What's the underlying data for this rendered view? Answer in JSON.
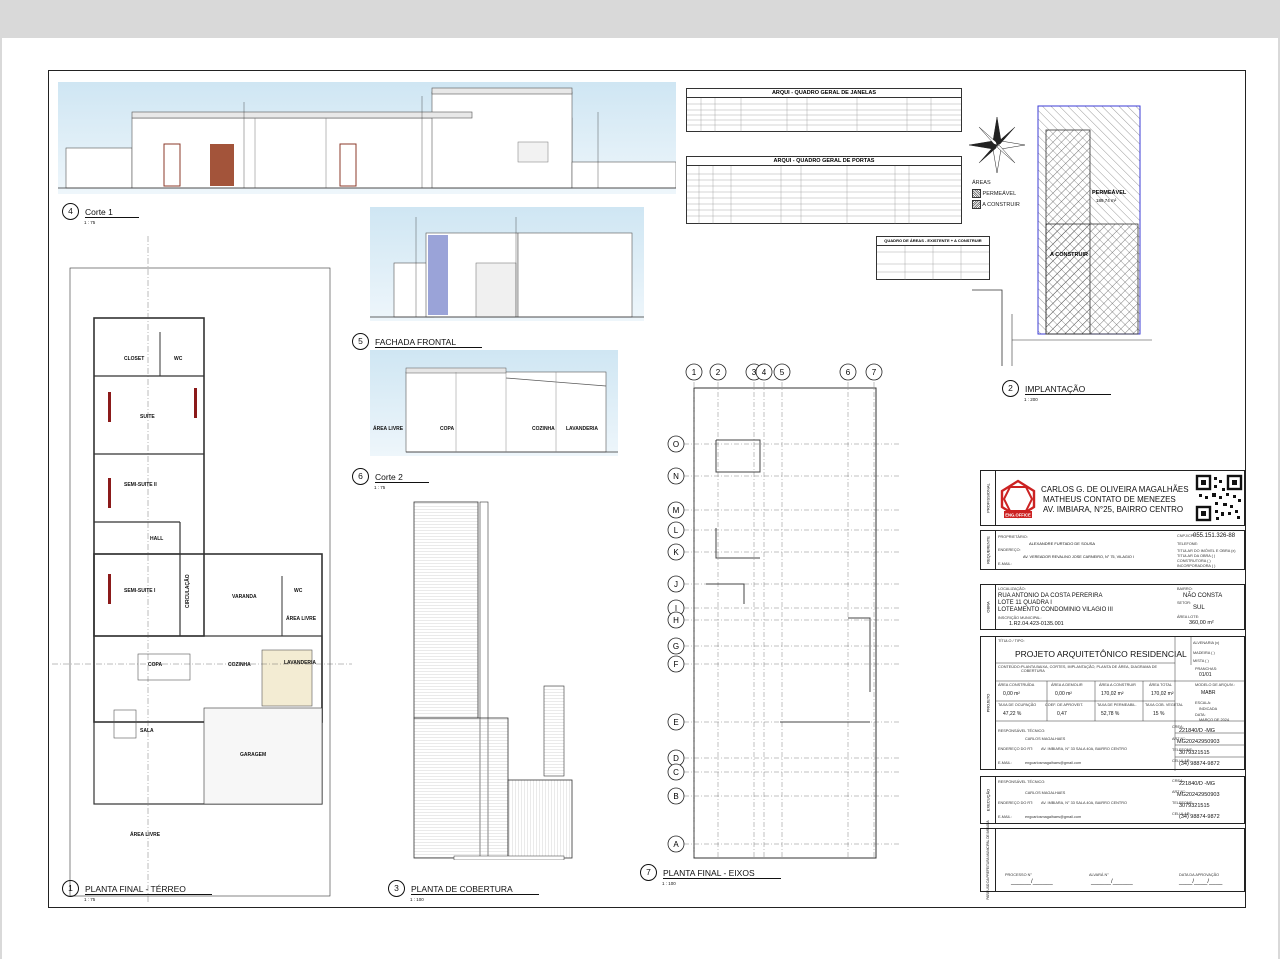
{
  "views": {
    "v1": {
      "num": "1",
      "name": "PLANTA FINAL - TÉRREO",
      "scale": "1 : 75"
    },
    "v2": {
      "num": "2",
      "name": "IMPLANTAÇÃO",
      "scale": "1 : 200"
    },
    "v3": {
      "num": "3",
      "name": "PLANTA DE COBERTURA",
      "scale": "1 : 100"
    },
    "v4": {
      "num": "4",
      "name": "Corte 1",
      "scale": "1 : 75"
    },
    "v5": {
      "num": "5",
      "name": "FACHADA FRONTAL",
      "scale": "1 : 75"
    },
    "v6": {
      "num": "6",
      "name": "Corte 2",
      "scale": "1 : 75"
    },
    "v7": {
      "num": "7",
      "name": "PLANTA FINAL - EIXOS",
      "scale": "1 : 100"
    }
  },
  "rooms": {
    "closet": "CLOSET",
    "wc": "WC",
    "suite": "SUITE",
    "semisuite2": "SEMI-SUITE II",
    "hall": "HALL",
    "semisuite1": "SEMI-SUITE I",
    "circulacao": "CIRCULAÇÃO",
    "varanda": "VARANDA",
    "wc2": "WC",
    "arealivre": "ÁREA LIVRE",
    "copa": "COPA",
    "cozinha": "COZINHA",
    "lavanderia": "LAVANDERIA",
    "sala": "SALA",
    "garagem": "GARAGEM",
    "arealivre2": "ÁREA LIVRE"
  },
  "corte2": {
    "arealivre": "ÁREA LIVRE",
    "copa": "COPA",
    "cozinha": "COZINHA",
    "lavanderia": "LAVANDERIA"
  },
  "implantacao": {
    "permeavel": "PERMEÁVEL",
    "permeavel_area": "189,74 m²",
    "aconstruir": "A CONSTRUIR"
  },
  "legend": {
    "title": "ÁREAS",
    "permeavel": "PERMEÁVEL",
    "aconstruir": "A CONSTRUIR"
  },
  "tables": {
    "janelas": "ARQUI - QUADRO GERAL DE JANELAS",
    "portas": "ARQUI - QUADRO GERAL DE PORTAS",
    "areas": "QUADRO DE ÁREAS - EXISTENTE + A CONSTRUIR"
  },
  "axes": {
    "cols": [
      "1",
      "2",
      "3",
      "4",
      "5",
      "6",
      "7"
    ],
    "rows": [
      "O",
      "N",
      "M",
      "L",
      "K",
      "J",
      "I",
      "H",
      "G",
      "F",
      "E",
      "D",
      "C",
      "B",
      "A"
    ]
  },
  "titleblock": {
    "company_line1": "CARLOS G. DE OLIVEIRA MAGALHÃES",
    "company_line2": "MATHEUS CONTATO DE MENEZES",
    "company_line3": "AV. IMBIARA, N°25, BAIRRO CENTRO",
    "logo_text": "ENG.OFFICE",
    "side_profissional": "PROFISSIONAL",
    "side_requerente": "REQUERENTE",
    "side_obra": "OBRA",
    "side_projeto": "PROJETO",
    "side_execucao": "EXECUÇÃO",
    "side_prefeitura": "PARA USO DA PREFEITURA MUNICIPAL DE IMBIARA",
    "proprietario_lbl": "PROPRIETÁRIO:",
    "proprietario": "ALEXANDRE FURTADO DE SOUSA",
    "endereco_lbl": "ENDEREÇO:",
    "endereco": "AV. VEREADOR REVALINO JOSE CARNEIRO, N° 75, VILAGIO I",
    "email_lbl": "E-MAIL:",
    "cpf_lbl": "CNPJ/CPF:",
    "cpf": "055.151.326-88",
    "telefone_lbl": "TELEFONE:",
    "tit1": "TITULAR DO IMÓVEL E OBRA (x)",
    "tit2": "TITULAR DA OBRA ( )",
    "tit3": "CONSTRUTORA ( )",
    "tit4": "INCORPORADORA ( )",
    "localizacao_lbl": "LOCALIZAÇÃO:",
    "loc1": "RUA ANTONIO DA COSTA PERERIRA",
    "loc2": "LOTE 11 QUADRA I",
    "loc3": "LOTEAMENTO CONDOMINIO VILAGIO III",
    "inscricao_lbl": "INSCRIÇÃO MUNICIPAL:",
    "inscricao": "1.R2.04.423-0135.001",
    "bairro_lbl": "BAIRRO:",
    "bairro": "NÃO CONSTA",
    "setor_lbl": "SETOR:",
    "setor": "SUL",
    "area_lote_lbl": "ÁREA LOTE:",
    "area_lote": "360,00 m²",
    "titulo_lbl": "TÍTULO / TIPO:",
    "titulo": "PROJETO ARQUITETÔNICO RESIDENCIAL",
    "conteudo_lbl": "CONTEÚDO:",
    "conteudo": "PLANTA BAIXA, CORTES, IMPLANTAÇÃO, PLANTA DE ÁREA, DIAGRAMA DE COBERTURA",
    "alvenaria": "ALVENARIA (x)",
    "madeira": "MADEIRA ( )",
    "mista": "MISTA ( )",
    "pranchas_lbl": "PRANCHAS:",
    "pranchas": "01/01",
    "modelo_lbl": "MODELO DE ARQUIV.:",
    "modelo": "MABR",
    "escala_lbl": "ESCALA:",
    "escala": "INDICADA",
    "data_lbl": "DATA:",
    "data": "MARÇO DE 2024",
    "area_constr_lbl": "ÁREA CONSTRUÍDA",
    "area_constr": "0,00 m²",
    "area_demolir_lbl": "ÁREA A DEMOLIR",
    "area_demolir": "0,00 m²",
    "area_aconstr_lbl": "ÁREA A CONSTRUIR",
    "area_aconstr": "170,02 m²",
    "area_total_lbl": "ÁREA TOTAL",
    "area_total": "170,02 m²",
    "taxa_ocup_lbl": "TAXA DE OCUPAÇÃO",
    "taxa_ocup": "47,22 %",
    "coef_lbl": "COEF. DE APROVEIT.",
    "coef": "0,47",
    "taxa_perm_lbl": "TAXA DE PERMEABIL.",
    "taxa_perm": "52,78 %",
    "taxa_veg_lbl": "TAXA COB. VEGETAL",
    "taxa_veg": "15 %",
    "resp_lbl": "RESPONSÁVEL TÉCNICO:",
    "resp": "CARLOS MAGALHAES",
    "end_resp_lbl": "ENDEREÇO DO RT:",
    "end_resp": "AV. IMBIARA, N° 33 SALA 40A, BAIRRO CENTRO",
    "email_resp": "engcarlosmagalhaes@gmail.com",
    "crea_lbl": "CREA:",
    "crea": "221840/D -MG",
    "art_lbl": "ART N°:",
    "art": "MG20242950903",
    "tel_lbl": "TELEFONE:",
    "tel": "3079321515",
    "cel_lbl": "CELULAR:",
    "cel": "(34) 98874-9872",
    "processo_lbl": "PROCESSO N°",
    "alvara_lbl": "ALVARÁ N°",
    "aprov_lbl": "DATA DA APROVAÇÃO"
  }
}
